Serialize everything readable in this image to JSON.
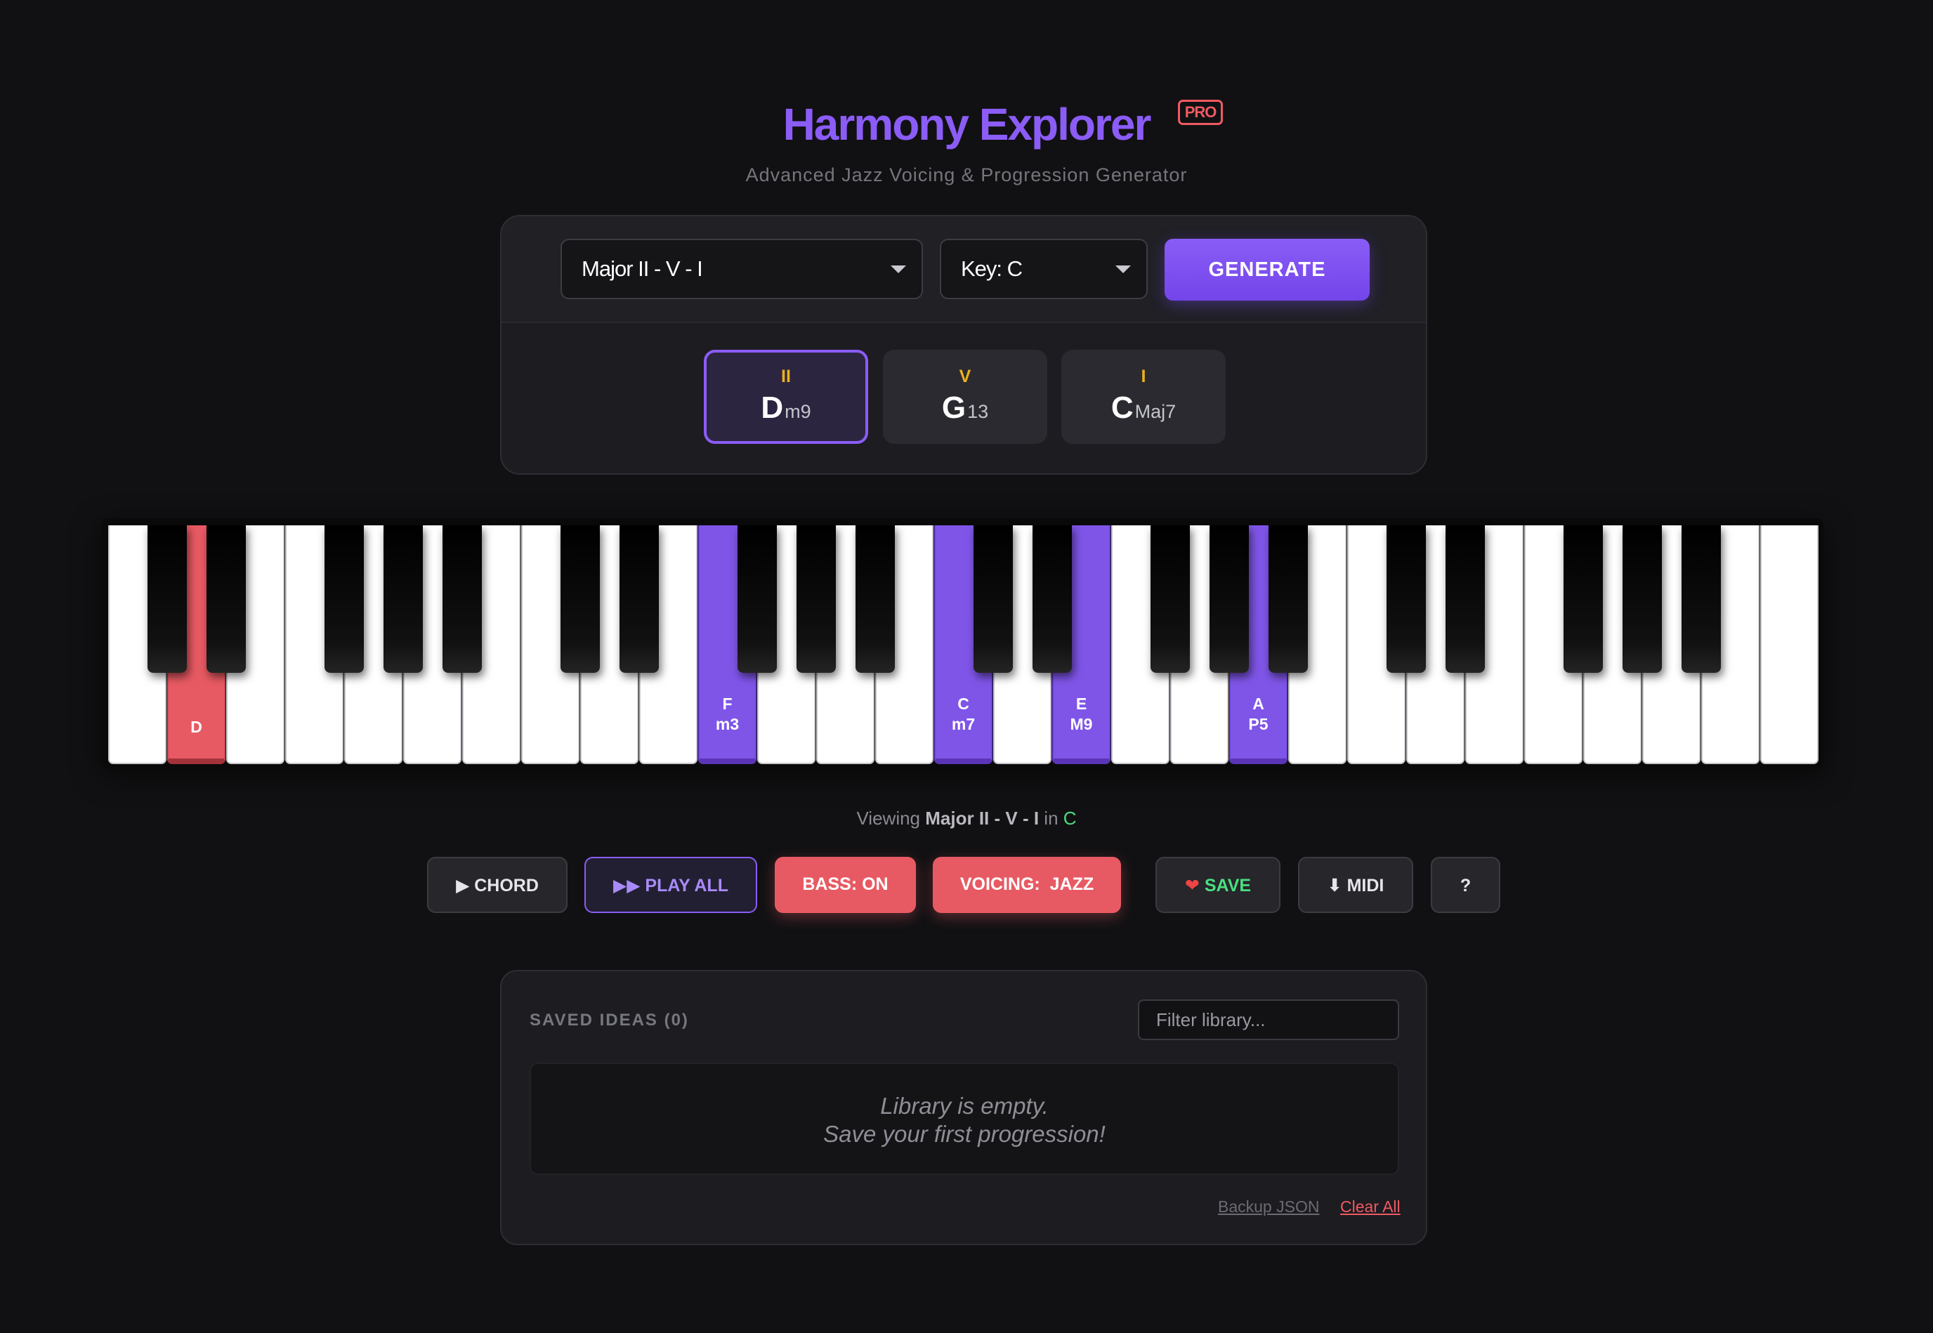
{
  "header": {
    "title": "Harmony Explorer",
    "badge": "PRO",
    "subtitle": "Advanced Jazz Voicing & Progression Generator"
  },
  "controls": {
    "progression_value": "Major II - V - I",
    "key_value": "Key: C",
    "generate_label": "GENERATE"
  },
  "chords": [
    {
      "roman": "II",
      "root": "D",
      "quality": "m9",
      "active": true
    },
    {
      "roman": "V",
      "root": "G",
      "quality": "13",
      "active": false
    },
    {
      "roman": "I",
      "root": "C",
      "quality": "Maj7",
      "active": false
    }
  ],
  "piano": {
    "highlighted": [
      {
        "note": "D",
        "interval": "",
        "color": "red"
      },
      {
        "note": "F",
        "interval": "m3",
        "color": "purple"
      },
      {
        "note": "C",
        "interval": "m7",
        "color": "purple"
      },
      {
        "note": "E",
        "interval": "M9",
        "color": "purple"
      },
      {
        "note": "A",
        "interval": "P5",
        "color": "purple"
      }
    ]
  },
  "status": {
    "prefix": "Viewing",
    "progression": "Major II - V - I",
    "connector": "in",
    "key": "C"
  },
  "actions": {
    "chord": "CHORD",
    "play_all": "PLAY ALL",
    "bass": "BASS: ON",
    "voicing": "VOICING:  JAZZ",
    "save": "SAVE",
    "midi": "MIDI",
    "help": "?"
  },
  "library": {
    "title": "SAVED IDEAS (0)",
    "filter_placeholder": "Filter library...",
    "empty_line1": "Library is empty.",
    "empty_line2": "Save your first progression!",
    "backup_label": "Backup JSON",
    "clear_label": "Clear All"
  },
  "colors": {
    "accent": "#8b5cf6",
    "bass_highlight": "#e85a63",
    "roman_numeral": "#e9b21c",
    "key_green": "#4ade80",
    "background": "#111113"
  },
  "icons": {
    "play": "play-icon",
    "play_all": "fast-forward-icon",
    "save": "heart-icon",
    "midi": "download-arrow-icon",
    "dropdown": "chevron-down-icon"
  }
}
